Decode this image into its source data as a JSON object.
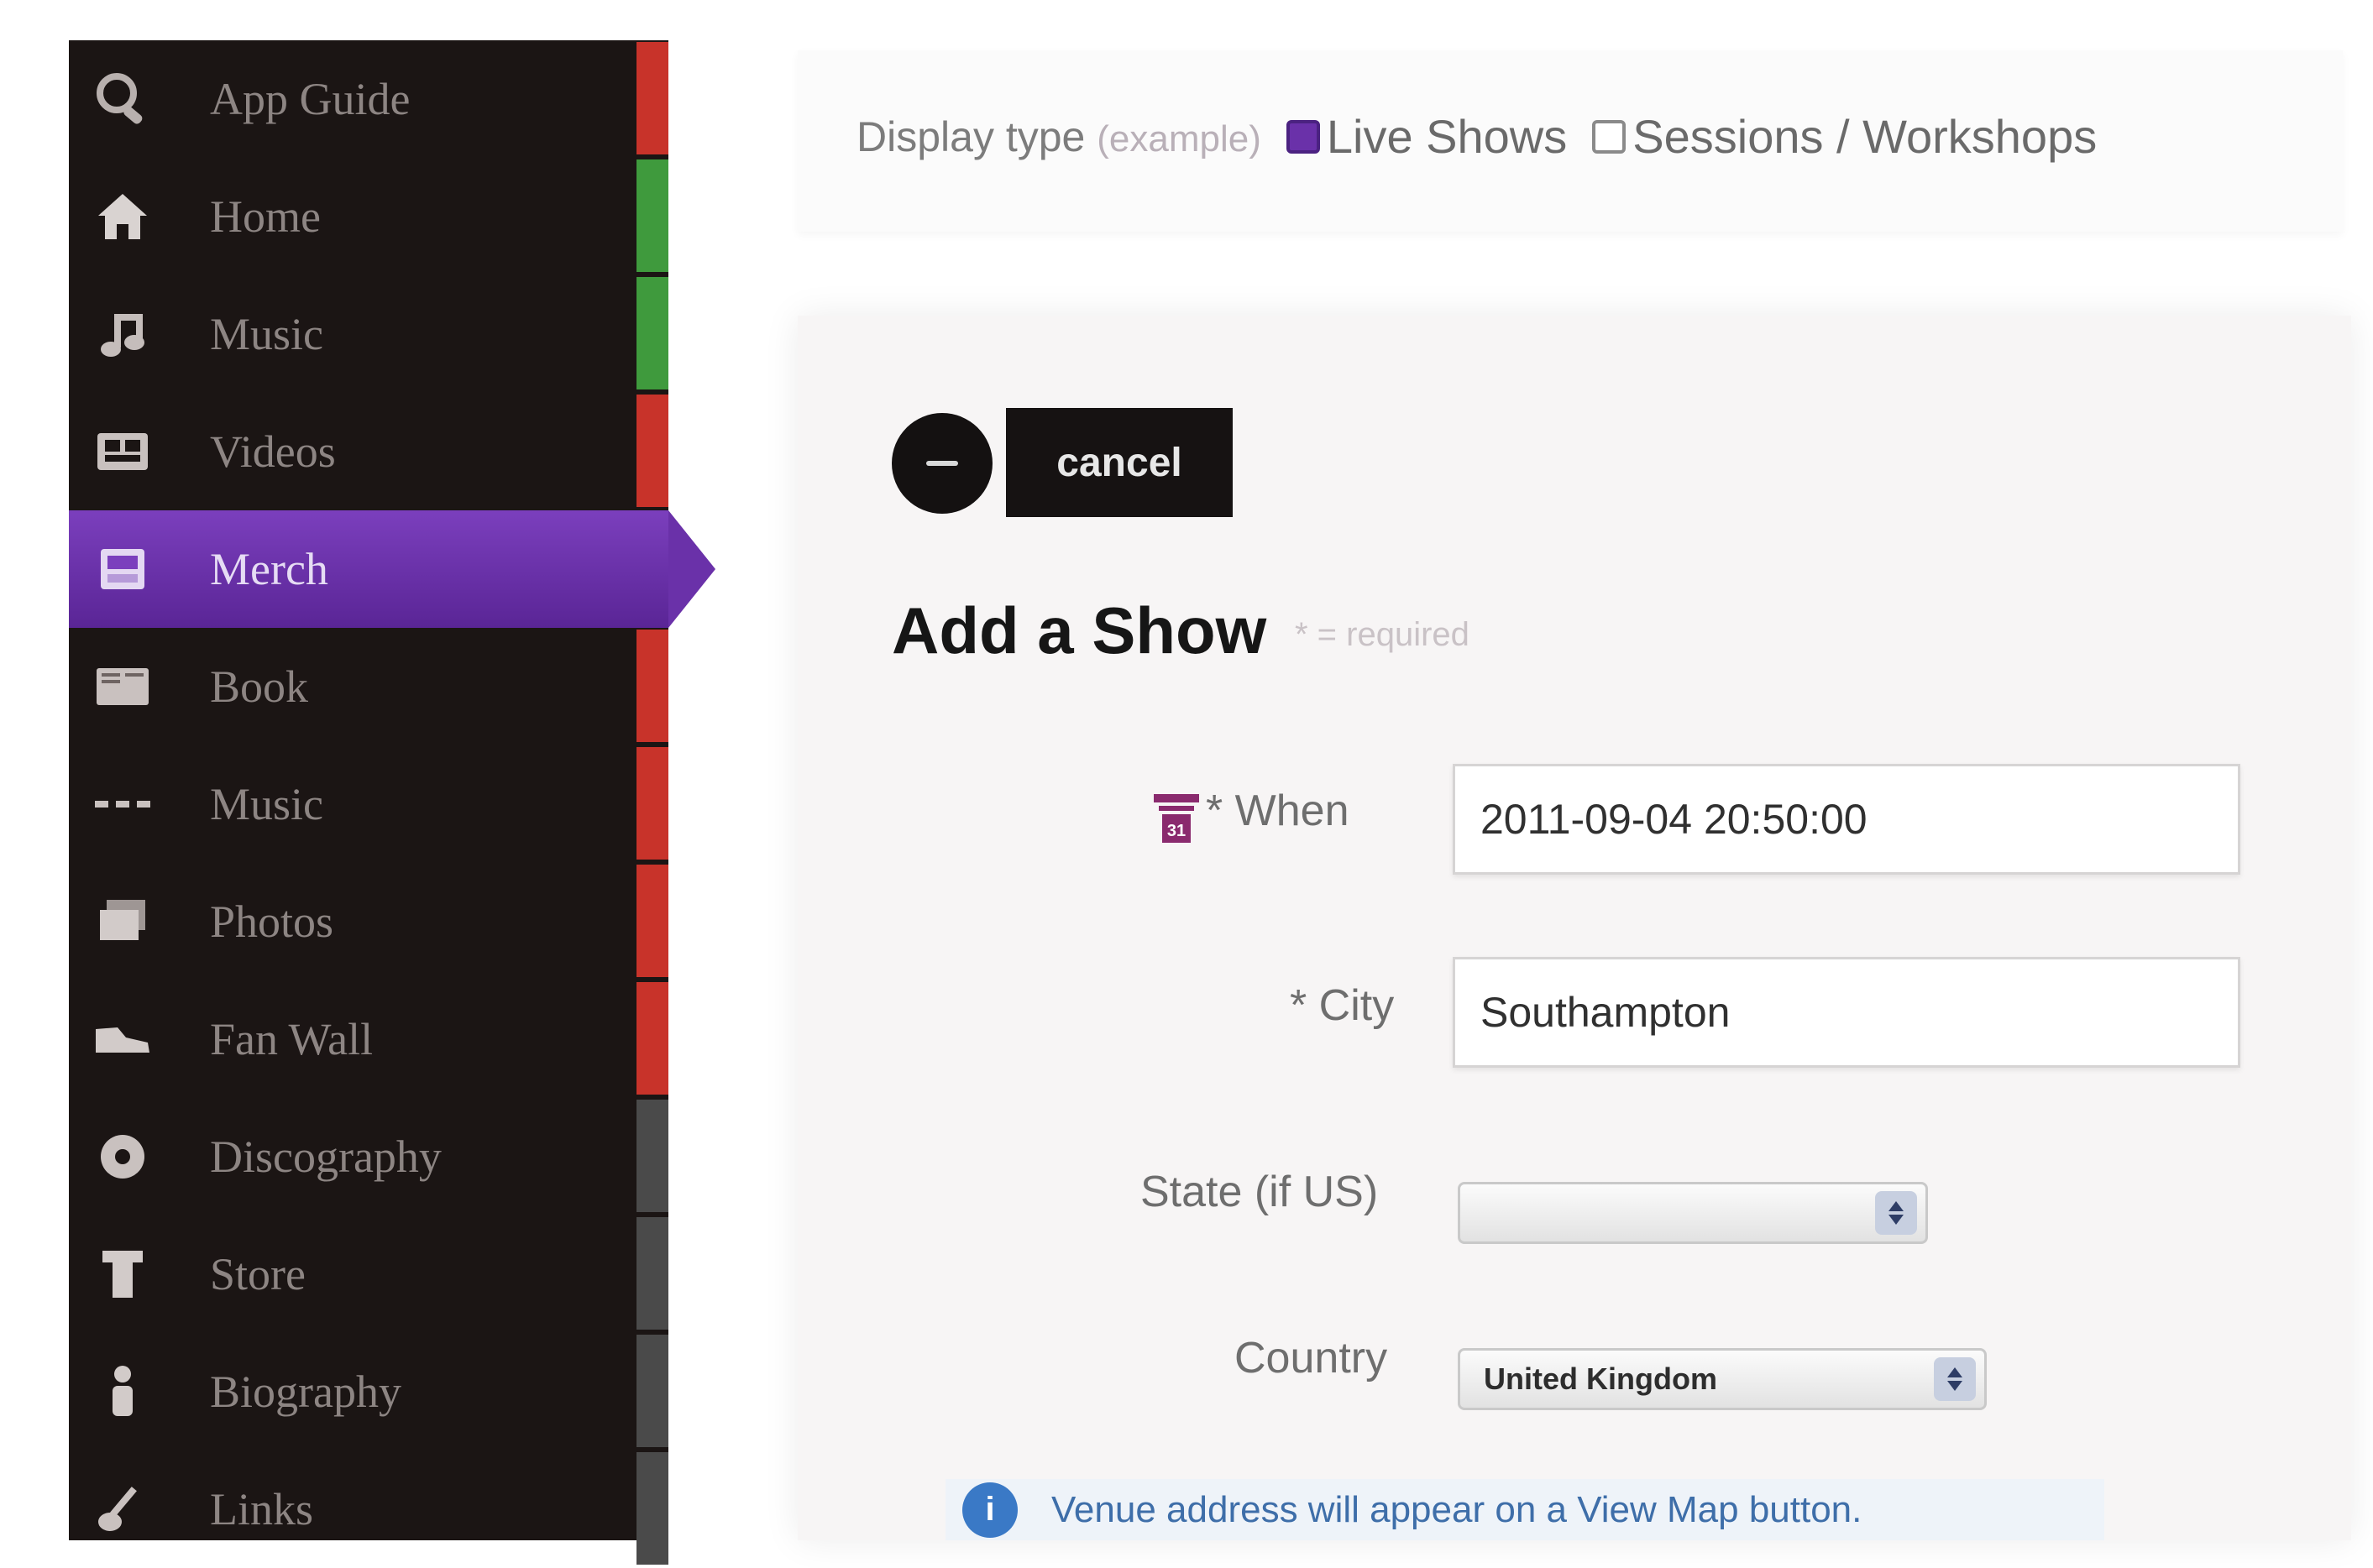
{
  "sidebar": {
    "items": [
      {
        "label": "App Guide",
        "icon": "magnifier-icon",
        "strip": "#c8332a"
      },
      {
        "label": "Home",
        "icon": "home-icon",
        "strip": "#3f9a3d"
      },
      {
        "label": "Music",
        "icon": "music-icon",
        "strip": "#3f9a3d"
      },
      {
        "label": "Videos",
        "icon": "video-icon",
        "strip": "#c8332a"
      },
      {
        "label": "Merch",
        "icon": "store-icon",
        "strip": "#c8332a",
        "active": true
      },
      {
        "label": "Book",
        "icon": "book-icon",
        "strip": "#c8332a"
      },
      {
        "label": "Music",
        "icon": "dots-icon",
        "strip": "#c8332a"
      },
      {
        "label": "Photos",
        "icon": "photos-icon",
        "strip": "#c8332a"
      },
      {
        "label": "Fan Wall",
        "icon": "shoe-icon",
        "strip": "#c8332a"
      },
      {
        "label": "Discography",
        "icon": "disc-icon",
        "strip": "#4a4a4a"
      },
      {
        "label": "Store",
        "icon": "shirt-icon",
        "strip": "#4a4a4a"
      },
      {
        "label": "Biography",
        "icon": "person-icon",
        "strip": "#4a4a4a"
      },
      {
        "label": "Links",
        "icon": "guitar-icon",
        "strip": "#4a4a4a"
      }
    ]
  },
  "topbar": {
    "display_type_label": "Display type",
    "display_type_hint": "(example)",
    "option_live": "Live Shows",
    "option_sessions": "Sessions / Workshops",
    "live_checked": true,
    "sessions_checked": false
  },
  "form": {
    "cancel_label": "cancel",
    "title": "Add a Show",
    "required_note": "* = required",
    "when_label": "* When",
    "when_value": "2011-09-04 20:50:00",
    "city_label": "* City",
    "city_value": "Southampton",
    "state_label": "State (if US)",
    "state_value": "",
    "country_label": "Country",
    "country_value": "United Kingdom",
    "info_text": "Venue address will appear on a View Map button."
  },
  "colors": {
    "sidebar_bg": "#1b1514",
    "active_item": "#6a31a9",
    "strip_red": "#c8332a",
    "strip_green": "#3f9a3d",
    "info_blue": "#3a79c6"
  }
}
